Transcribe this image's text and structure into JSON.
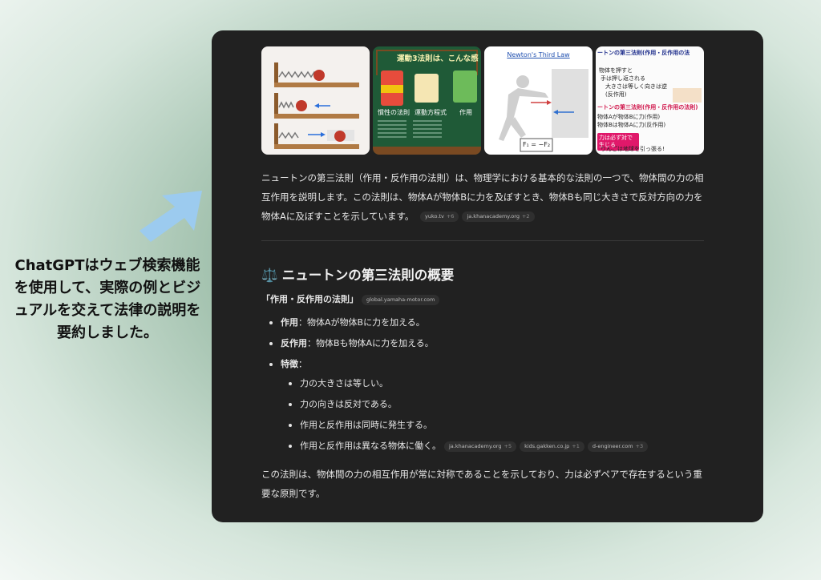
{
  "caption": "ChatGPTはウェブ検索機能を使用して、実際の例とビジュアルを交えて法律の説明を要約しました。",
  "colors": {
    "panel": "#212121",
    "arrow": "#9ccbef",
    "text": "#e6e6e6"
  },
  "images": [
    {
      "icon": "spring-cart-diagram"
    },
    {
      "icon": "blackboard-three-laws",
      "title": "運動3法則は、こんな感",
      "labels": [
        "慣性の法則",
        "運動方程式",
        "作用"
      ]
    },
    {
      "icon": "newtons-third-law-push-wall",
      "title": "Newton's Third Law",
      "formula": "F₁ = −F₂"
    },
    {
      "icon": "action-reaction-notes",
      "title": "ートンの第三法則(作用・反作用の法",
      "lines": [
        "物体を押すと",
        "手は押し返される",
        "大きさは等しく向きは逆",
        "(反作用)",
        "ートンの第三法則(作用・反作用の法則)",
        "物体Aが物体Bに力(作用)",
        "物体Bは物体Aに力(反作用)",
        "力は必ず対で生じる",
        "りんごは地球を引っ張る!"
      ]
    }
  ],
  "intro": {
    "text": "ニュートンの第三法則（作用・反作用の法則）は、物理学における基本的な法則の一つで、物体間の力の相互作用を説明します。この法則は、物体Aが物体Bに力を及ぼすとき、物体Bも同じ大きさで反対方向の力を物体Aに及ぼすことを示しています。",
    "sources": [
      {
        "name": "yuko.tv",
        "count": "+6"
      },
      {
        "name": "ja.khanacademy.org",
        "count": "+2"
      }
    ]
  },
  "section": {
    "emoji": "⚖️",
    "title": "ニュートンの第三法則の概要",
    "law_label": "「作用・反作用の法則」",
    "law_source": "global.yamaha-motor.com",
    "items": [
      {
        "term": "作用",
        "desc": "：物体Aが物体Bに力を加える。"
      },
      {
        "term": "反作用",
        "desc": "：物体Bも物体Aに力を加える。"
      },
      {
        "term": "特徴",
        "desc": "："
      }
    ],
    "features": [
      "力の大きさは等しい。",
      "力の向きは反対である。",
      "作用と反作用は同時に発生する。",
      "作用と反作用は異なる物体に働く。"
    ],
    "feature_sources": [
      {
        "name": "ja.khanacademy.org",
        "count": "+5"
      },
      {
        "name": "kids.gakken.co.jp",
        "count": "+1"
      },
      {
        "name": "d-engineer.com",
        "count": "+3"
      }
    ],
    "conclusion": "この法則は、物体間の力の相互作用が常に対称であることを示しており、力は必ずペアで存在するという重要な原則です。"
  }
}
